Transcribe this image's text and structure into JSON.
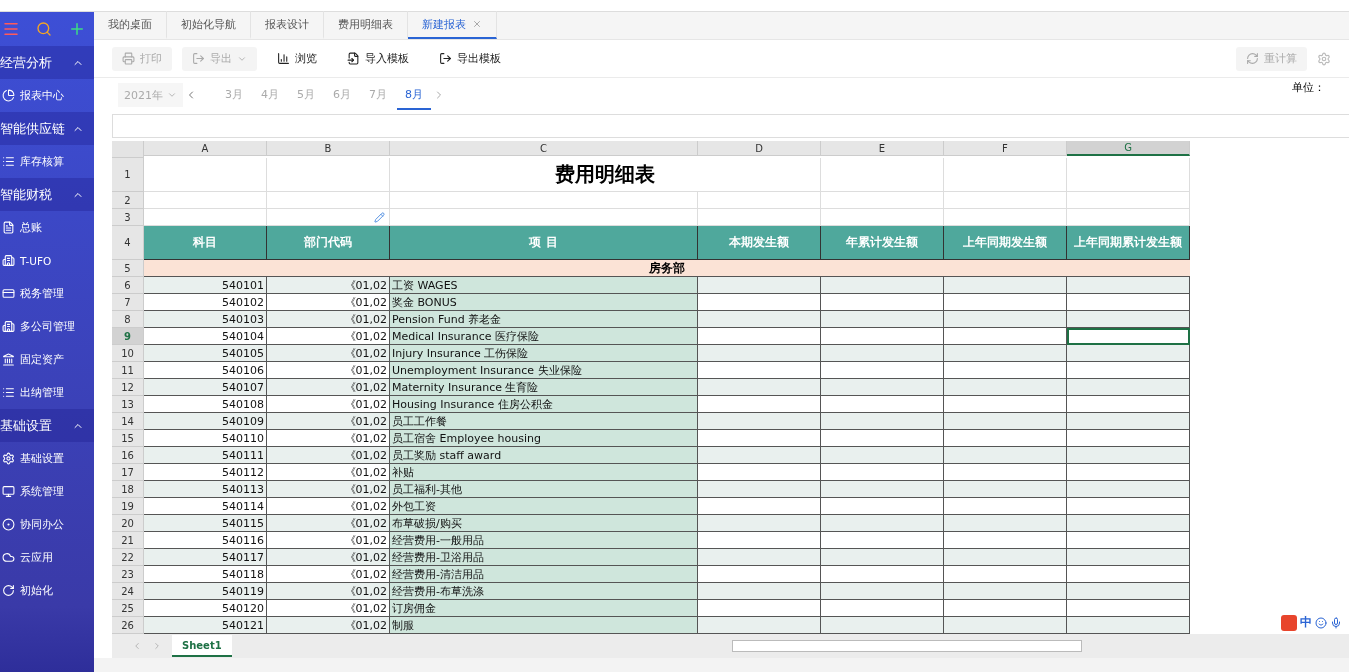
{
  "sidebar": {
    "groups": [
      {
        "title": "经营分析",
        "expanded": true,
        "items": [
          {
            "label": "报表中心"
          }
        ]
      },
      {
        "title": "智能供应链",
        "expanded": true,
        "items": [
          {
            "label": "库存核算"
          }
        ]
      },
      {
        "title": "智能财税",
        "expanded": true,
        "items": [
          {
            "label": "总账"
          },
          {
            "label": "T-UFO"
          },
          {
            "label": "税务管理"
          },
          {
            "label": "多公司管理"
          },
          {
            "label": "固定资产"
          },
          {
            "label": "出纳管理"
          }
        ]
      },
      {
        "title": "基础设置",
        "expanded": true,
        "items": [
          {
            "label": "基础设置"
          },
          {
            "label": "系统管理"
          },
          {
            "label": "协同办公"
          },
          {
            "label": "云应用"
          },
          {
            "label": "初始化"
          }
        ]
      }
    ]
  },
  "tabs": [
    {
      "label": "我的桌面",
      "selected": false,
      "closable": false
    },
    {
      "label": "初始化导航",
      "selected": false,
      "closable": false
    },
    {
      "label": "报表设计",
      "selected": false,
      "closable": false
    },
    {
      "label": "费用明细表",
      "selected": false,
      "closable": false
    },
    {
      "label": "新建报表",
      "selected": true,
      "closable": true
    }
  ],
  "toolbar": [
    {
      "label": "打印",
      "kind": "print",
      "disabled": true,
      "dropdown": false
    },
    {
      "label": "导出",
      "kind": "export",
      "disabled": true,
      "dropdown": true
    },
    {
      "label": "浏览",
      "kind": "preview",
      "disabled": false,
      "dropdown": false
    },
    {
      "label": "导入模板",
      "kind": "import",
      "disabled": false,
      "dropdown": false
    },
    {
      "label": "导出模板",
      "kind": "export",
      "disabled": false,
      "dropdown": false
    }
  ],
  "recalc_button": {
    "label": "重计算",
    "disabled": true
  },
  "period": {
    "year": "2021年",
    "months": [
      {
        "label": "3月",
        "selected": false
      },
      {
        "label": "4月",
        "selected": false
      },
      {
        "label": "5月",
        "selected": false
      },
      {
        "label": "6月",
        "selected": false
      },
      {
        "label": "7月",
        "selected": false
      },
      {
        "label": "8月",
        "selected": true
      }
    ]
  },
  "unit_label": "单位：",
  "sheet": {
    "columns": [
      {
        "label": "A",
        "selected": false
      },
      {
        "label": "B",
        "selected": false
      },
      {
        "label": "C",
        "selected": false
      },
      {
        "label": "D",
        "selected": false
      },
      {
        "label": "E",
        "selected": false
      },
      {
        "label": "F",
        "selected": false
      },
      {
        "label": "G",
        "selected": true
      }
    ],
    "top_rows": [
      "1",
      "2",
      "3",
      "4",
      "5"
    ],
    "title": "费用明细表",
    "headers": [
      "科目",
      "部门代码",
      "项 目",
      "本期发生额",
      "年累计发生额",
      "上年同期发生额",
      "上年同期累计发生额"
    ],
    "section": "房务部",
    "rows": [
      {
        "num": "6",
        "code": "540101",
        "dept": "《01,02",
        "item": "工资  WAGES",
        "selected": false
      },
      {
        "num": "7",
        "code": "540102",
        "dept": "《01,02",
        "item": "奖金  BONUS",
        "selected": false
      },
      {
        "num": "8",
        "code": "540103",
        "dept": "《01,02",
        "item": "Pension Fund 养老金",
        "selected": false
      },
      {
        "num": "9",
        "code": "540104",
        "dept": "《01,02",
        "item": "Medical Insurance 医疗保险",
        "selected": true
      },
      {
        "num": "10",
        "code": "540105",
        "dept": "《01,02",
        "item": "Injury Insurance 工伤保险",
        "selected": false
      },
      {
        "num": "11",
        "code": "540106",
        "dept": "《01,02",
        "item": "Unemployment Insurance 失业保险",
        "selected": false
      },
      {
        "num": "12",
        "code": "540107",
        "dept": "《01,02",
        "item": "Maternity Insurance 生育险",
        "selected": false
      },
      {
        "num": "13",
        "code": "540108",
        "dept": "《01,02",
        "item": "Housing Insurance 住房公积金",
        "selected": false
      },
      {
        "num": "14",
        "code": "540109",
        "dept": "《01,02",
        "item": "员工工作餐",
        "selected": false
      },
      {
        "num": "15",
        "code": "540110",
        "dept": "《01,02",
        "item": "员工宿舍 Employee housing",
        "selected": false
      },
      {
        "num": "16",
        "code": "540111",
        "dept": "《01,02",
        "item": "员工奖励 staff award",
        "selected": false
      },
      {
        "num": "17",
        "code": "540112",
        "dept": "《01,02",
        "item": "补贴",
        "selected": false
      },
      {
        "num": "18",
        "code": "540113",
        "dept": "《01,02",
        "item": "员工福利-其他",
        "selected": false
      },
      {
        "num": "19",
        "code": "540114",
        "dept": "《01,02",
        "item": "外包工资",
        "selected": false
      },
      {
        "num": "20",
        "code": "540115",
        "dept": "《01,02",
        "item": "布草破损/购买",
        "selected": false
      },
      {
        "num": "21",
        "code": "540116",
        "dept": "《01,02",
        "item": "经营费用-一般用品",
        "selected": false
      },
      {
        "num": "22",
        "code": "540117",
        "dept": "《01,02",
        "item": "经营费用-卫浴用品",
        "selected": false
      },
      {
        "num": "23",
        "code": "540118",
        "dept": "《01,02",
        "item": "经营费用-清洁用品",
        "selected": false
      },
      {
        "num": "24",
        "code": "540119",
        "dept": "《01,02",
        "item": "经营费用-布草洗涤",
        "selected": false
      },
      {
        "num": "25",
        "code": "540120",
        "dept": "《01,02",
        "item": "订房佣金",
        "selected": false
      },
      {
        "num": "26",
        "code": "540121",
        "dept": "《01,02",
        "item": "制服",
        "selected": false
      }
    ]
  },
  "sheet_tabs": [
    {
      "label": "Sheet1",
      "selected": true
    }
  ],
  "ime": {
    "label": "中"
  }
}
